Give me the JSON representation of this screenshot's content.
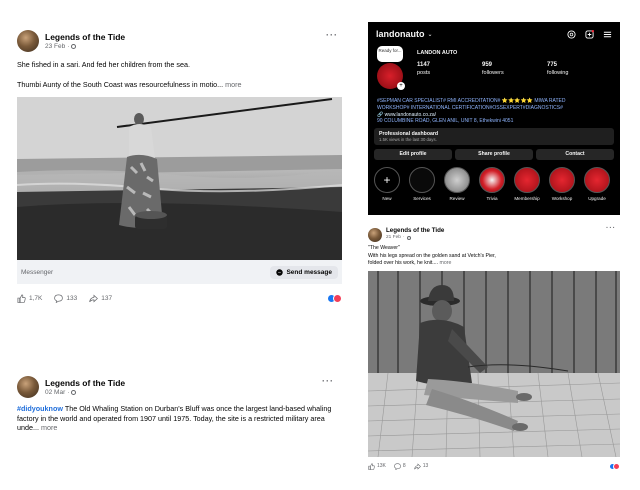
{
  "post_top": {
    "author": "Legends of the Tide",
    "date": "23 Feb",
    "caption_line1": "She fished in a sari. And fed her children from the sea.",
    "caption_line2": "Thumbi Aunty of the South Coast was resourcefulness in motio...",
    "more_label": "more",
    "messenger_label": "Messenger",
    "send_message_label": "Send message",
    "likes": "1,7K",
    "comments": "133",
    "shares": "137"
  },
  "post_bottom": {
    "author": "Legends of the Tide",
    "date": "02 Mar",
    "hashtag": "#didyouknow",
    "caption": "The Old Whaling Station on Durban's Bluff was once the largest land-based whaling factory in the world and operated from 1907 until 1975. Today, the site is a restricted military area unde...",
    "more_label": "more"
  },
  "instagram": {
    "username": "landonauto",
    "bubble_text": "Ready for...",
    "display_name": "LANDON AUTO",
    "stats": [
      {
        "value": "1147",
        "label": "posts"
      },
      {
        "value": "959",
        "label": "followers"
      },
      {
        "value": "775",
        "label": "following"
      }
    ],
    "bio_line1": "#SEPMAN CAR SPECIALIST# RMI ACCREDITATION# ⭐⭐⭐⭐⭐ MIWA RATED",
    "bio_line2": "WORKSHOP# INTERNATIONAL CERTIFICATION#OSSEXPERT#DIAGNOSTICS#",
    "bio_line3": "🔗 www.landonauto.co.za/",
    "bio_line4": "90 COLUMBINE ROAD, GLEN ANIL, UNIT 8, Ethekwini 4051",
    "dashboard_title": "Professional dashboard",
    "dashboard_sub": "1.5K views in the last 30 days.",
    "buttons": [
      "Edit profile",
      "Share profile",
      "Contact"
    ],
    "highlights": [
      {
        "label": "New",
        "style": "new"
      },
      {
        "label": "Services",
        "style": "black"
      },
      {
        "label": "Review",
        "style": "gray"
      },
      {
        "label": "Trivia",
        "style": "mix"
      },
      {
        "label": "Membership",
        "style": "red"
      },
      {
        "label": "Workshop",
        "style": "red"
      },
      {
        "label": "Upgrade",
        "style": "red"
      }
    ]
  },
  "post_right": {
    "author": "Legends of the Tide",
    "date": "21 Feb",
    "caption_line1": "\"The Weaver\"",
    "caption_line2": "With his legs spread on the golden sand at Vetch's Pier,",
    "caption_line3": "folded over his work, he knit....",
    "more_label": "more",
    "likes": "13K",
    "comments": "8",
    "shares": "13"
  }
}
